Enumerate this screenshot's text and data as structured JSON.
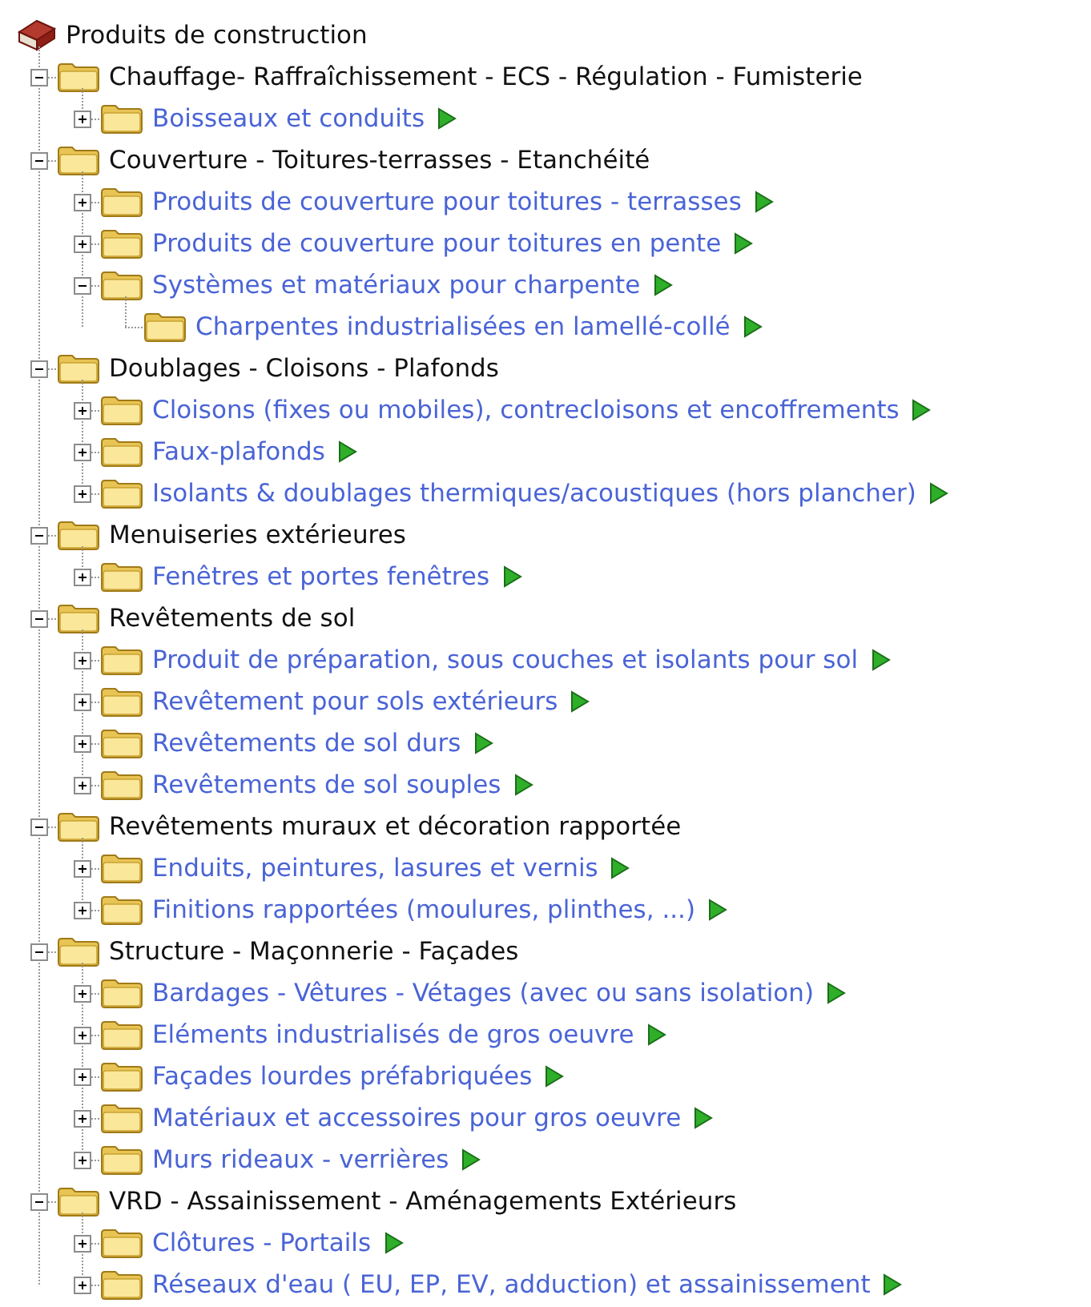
{
  "tree": {
    "label": "Produits de construction",
    "kind": "root",
    "children": [
      {
        "label": "Chauffage- Raffraîchissement - ECS - Régulation - Fumisterie",
        "kind": "category",
        "expanded": true,
        "children": [
          {
            "label": "Boisseaux et conduits",
            "kind": "link",
            "expanded": false
          }
        ]
      },
      {
        "label": "Couverture - Toitures-terrasses - Etanchéité",
        "kind": "category",
        "expanded": true,
        "children": [
          {
            "label": "Produits de couverture pour toitures - terrasses",
            "kind": "link",
            "expanded": false
          },
          {
            "label": "Produits de couverture pour toitures en pente",
            "kind": "link",
            "expanded": false
          },
          {
            "label": "Systèmes et matériaux pour charpente",
            "kind": "link",
            "expanded": true,
            "children": [
              {
                "label": "Charpentes industrialisées en lamellé-collé",
                "kind": "link"
              }
            ]
          }
        ]
      },
      {
        "label": "Doublages - Cloisons - Plafonds",
        "kind": "category",
        "expanded": true,
        "children": [
          {
            "label": "Cloisons (fixes ou mobiles), contrecloisons et encoffrements",
            "kind": "link",
            "expanded": false
          },
          {
            "label": "Faux-plafonds",
            "kind": "link",
            "expanded": false
          },
          {
            "label": "Isolants & doublages thermiques/acoustiques (hors plancher)",
            "kind": "link",
            "expanded": false
          }
        ]
      },
      {
        "label": "Menuiseries extérieures",
        "kind": "category",
        "expanded": true,
        "children": [
          {
            "label": "Fenêtres et portes fenêtres",
            "kind": "link",
            "expanded": false
          }
        ]
      },
      {
        "label": "Revêtements de sol",
        "kind": "category",
        "expanded": true,
        "children": [
          {
            "label": "Produit de préparation, sous couches et isolants pour sol",
            "kind": "link",
            "expanded": false
          },
          {
            "label": "Revêtement pour sols extérieurs",
            "kind": "link",
            "expanded": false
          },
          {
            "label": "Revêtements de sol durs",
            "kind": "link",
            "expanded": false
          },
          {
            "label": "Revêtements de sol souples",
            "kind": "link",
            "expanded": false
          }
        ]
      },
      {
        "label": "Revêtements muraux et décoration rapportée",
        "kind": "category",
        "expanded": true,
        "children": [
          {
            "label": "Enduits, peintures, lasures et vernis",
            "kind": "link",
            "expanded": false
          },
          {
            "label": "Finitions rapportées (moulures, plinthes, ...)",
            "kind": "link",
            "expanded": false
          }
        ]
      },
      {
        "label": "Structure - Maçonnerie - Façades",
        "kind": "category",
        "expanded": true,
        "children": [
          {
            "label": "Bardages - Vêtures - Vétages (avec ou sans isolation)",
            "kind": "link",
            "expanded": false
          },
          {
            "label": "Eléments industrialisés de gros oeuvre",
            "kind": "link",
            "expanded": false
          },
          {
            "label": "Façades lourdes préfabriquées",
            "kind": "link",
            "expanded": false
          },
          {
            "label": "Matériaux et accessoires pour gros oeuvre",
            "kind": "link",
            "expanded": false
          },
          {
            "label": "Murs rideaux - verrières",
            "kind": "link",
            "expanded": false
          }
        ]
      },
      {
        "label": "VRD - Assainissement - Aménagements Extérieurs",
        "kind": "category",
        "expanded": true,
        "children": [
          {
            "label": "Clôtures - Portails",
            "kind": "link",
            "expanded": false
          },
          {
            "label": "Réseaux d'eau ( EU, EP, EV, adduction) et assainissement",
            "kind": "link",
            "expanded": false
          }
        ]
      }
    ]
  }
}
